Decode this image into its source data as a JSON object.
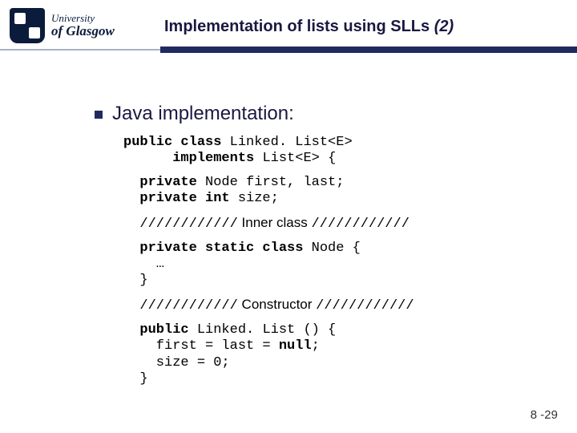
{
  "logo": {
    "line1": "University",
    "line2": "of Glasgow"
  },
  "title": {
    "main": "Implementation of lists using SLLs ",
    "suffix": "(2)"
  },
  "bullet": "Java implementation:",
  "code": {
    "l1a": "public class ",
    "l1b": "Linked. List<E>",
    "l2a": "implements",
    "l2b": " List<E> {",
    "l3": "private",
    "l3b": " Node first, last;",
    "l4": "private int",
    "l4b": " size;",
    "s1a": "////////////",
    "s1b": " Inner class ",
    "s1c": "////////////",
    "l5": "private static class",
    "l5b": " Node {",
    "l6": "    …",
    "l7": "}",
    "s2a": "////////////",
    "s2b": " Constructor ",
    "s2c": "////////////",
    "l8": "public",
    "l8b": " Linked. List () {",
    "l9": "    first = last = ",
    "l9b": "null",
    "l9c": ";",
    "l10": "    size = 0;",
    "l11": "}"
  },
  "pagenum": "8 -29"
}
